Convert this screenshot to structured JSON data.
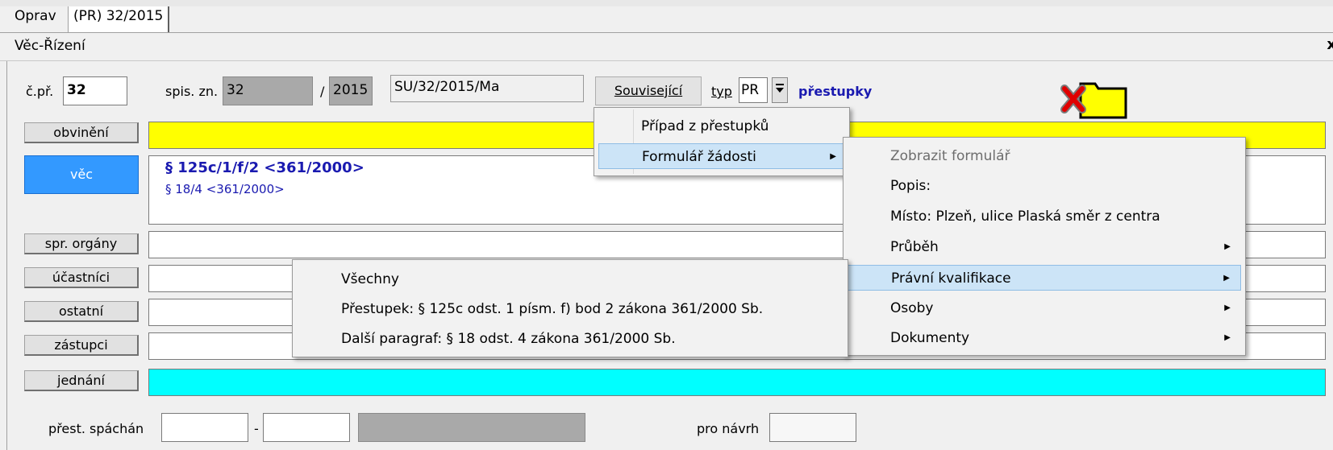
{
  "tabs": [
    {
      "label": "Oprav"
    },
    {
      "label": "(PR) 32/2015"
    }
  ],
  "panel": {
    "title": "Věc-Řízení",
    "close": "x"
  },
  "header": {
    "cpr_label": "č.př.",
    "cpr_value": "32",
    "spis_label": "spis. zn.",
    "spis_value": "32",
    "slash": "/",
    "year_value": "2015",
    "ref_value": "SU/32/2015/Ma",
    "souvisejici_label": "Související",
    "typ_label": "typ",
    "typ_value": "PR",
    "typ_desc": "přestupky"
  },
  "side_buttons": [
    {
      "label": "obvinění"
    },
    {
      "label": "věc"
    },
    {
      "label": "spr. orgány"
    },
    {
      "label": "účastníci"
    },
    {
      "label": "ostatní"
    },
    {
      "label": "zástupci"
    },
    {
      "label": "jednání"
    }
  ],
  "vec_lines": [
    "§ 125c/1/f/2 <361/2000>",
    "§ 18/4 <361/2000>"
  ],
  "bottom": {
    "prest_label": "přest. spáchán",
    "dash": "-",
    "pro_navrh_label": "pro návrh"
  },
  "menu1": {
    "items": [
      "Případ z přestupků",
      "Formulář žádosti"
    ]
  },
  "menu2": {
    "items": [
      "Zobrazit formulář",
      "Popis:",
      "Místo: Plzeň, ulice Plaská směr z centra",
      "Průběh",
      "Právní kvalifikace",
      "Osoby",
      "Dokumenty"
    ]
  },
  "menu3": {
    "items": [
      "Všechny",
      "Přestupek: § 125c odst. 1 písm. f) bod 2 zákona 361/2000 Sb.",
      "Další paragraf: § 18 odst. 4 zákona 361/2000 Sb."
    ]
  },
  "colors": {
    "yellow": "#ffff00",
    "cyan": "#00ffff",
    "selected_blue": "#3399ff",
    "menu_highlight": "#cce4f7"
  },
  "icons": [
    "delete-folder-icon",
    "submenu-arrow-icon",
    "dropdown-arrow-icon"
  ]
}
